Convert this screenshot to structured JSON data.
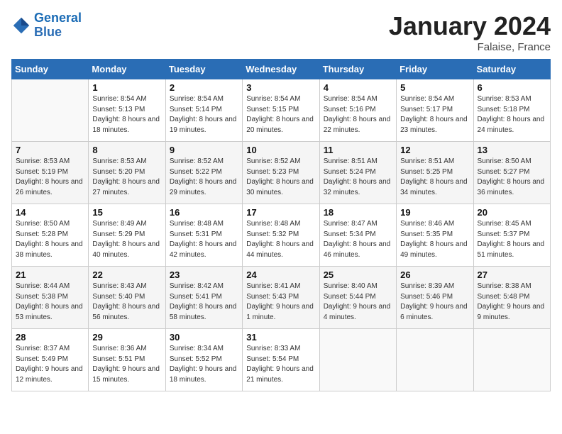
{
  "header": {
    "logo_line1": "General",
    "logo_line2": "Blue",
    "month_year": "January 2024",
    "location": "Falaise, France"
  },
  "weekdays": [
    "Sunday",
    "Monday",
    "Tuesday",
    "Wednesday",
    "Thursday",
    "Friday",
    "Saturday"
  ],
  "weeks": [
    [
      {
        "day": "",
        "sunrise": "",
        "sunset": "",
        "daylight": ""
      },
      {
        "day": "1",
        "sunrise": "Sunrise: 8:54 AM",
        "sunset": "Sunset: 5:13 PM",
        "daylight": "Daylight: 8 hours and 18 minutes."
      },
      {
        "day": "2",
        "sunrise": "Sunrise: 8:54 AM",
        "sunset": "Sunset: 5:14 PM",
        "daylight": "Daylight: 8 hours and 19 minutes."
      },
      {
        "day": "3",
        "sunrise": "Sunrise: 8:54 AM",
        "sunset": "Sunset: 5:15 PM",
        "daylight": "Daylight: 8 hours and 20 minutes."
      },
      {
        "day": "4",
        "sunrise": "Sunrise: 8:54 AM",
        "sunset": "Sunset: 5:16 PM",
        "daylight": "Daylight: 8 hours and 22 minutes."
      },
      {
        "day": "5",
        "sunrise": "Sunrise: 8:54 AM",
        "sunset": "Sunset: 5:17 PM",
        "daylight": "Daylight: 8 hours and 23 minutes."
      },
      {
        "day": "6",
        "sunrise": "Sunrise: 8:53 AM",
        "sunset": "Sunset: 5:18 PM",
        "daylight": "Daylight: 8 hours and 24 minutes."
      }
    ],
    [
      {
        "day": "7",
        "sunrise": "Sunrise: 8:53 AM",
        "sunset": "Sunset: 5:19 PM",
        "daylight": "Daylight: 8 hours and 26 minutes."
      },
      {
        "day": "8",
        "sunrise": "Sunrise: 8:53 AM",
        "sunset": "Sunset: 5:20 PM",
        "daylight": "Daylight: 8 hours and 27 minutes."
      },
      {
        "day": "9",
        "sunrise": "Sunrise: 8:52 AM",
        "sunset": "Sunset: 5:22 PM",
        "daylight": "Daylight: 8 hours and 29 minutes."
      },
      {
        "day": "10",
        "sunrise": "Sunrise: 8:52 AM",
        "sunset": "Sunset: 5:23 PM",
        "daylight": "Daylight: 8 hours and 30 minutes."
      },
      {
        "day": "11",
        "sunrise": "Sunrise: 8:51 AM",
        "sunset": "Sunset: 5:24 PM",
        "daylight": "Daylight: 8 hours and 32 minutes."
      },
      {
        "day": "12",
        "sunrise": "Sunrise: 8:51 AM",
        "sunset": "Sunset: 5:25 PM",
        "daylight": "Daylight: 8 hours and 34 minutes."
      },
      {
        "day": "13",
        "sunrise": "Sunrise: 8:50 AM",
        "sunset": "Sunset: 5:27 PM",
        "daylight": "Daylight: 8 hours and 36 minutes."
      }
    ],
    [
      {
        "day": "14",
        "sunrise": "Sunrise: 8:50 AM",
        "sunset": "Sunset: 5:28 PM",
        "daylight": "Daylight: 8 hours and 38 minutes."
      },
      {
        "day": "15",
        "sunrise": "Sunrise: 8:49 AM",
        "sunset": "Sunset: 5:29 PM",
        "daylight": "Daylight: 8 hours and 40 minutes."
      },
      {
        "day": "16",
        "sunrise": "Sunrise: 8:48 AM",
        "sunset": "Sunset: 5:31 PM",
        "daylight": "Daylight: 8 hours and 42 minutes."
      },
      {
        "day": "17",
        "sunrise": "Sunrise: 8:48 AM",
        "sunset": "Sunset: 5:32 PM",
        "daylight": "Daylight: 8 hours and 44 minutes."
      },
      {
        "day": "18",
        "sunrise": "Sunrise: 8:47 AM",
        "sunset": "Sunset: 5:34 PM",
        "daylight": "Daylight: 8 hours and 46 minutes."
      },
      {
        "day": "19",
        "sunrise": "Sunrise: 8:46 AM",
        "sunset": "Sunset: 5:35 PM",
        "daylight": "Daylight: 8 hours and 49 minutes."
      },
      {
        "day": "20",
        "sunrise": "Sunrise: 8:45 AM",
        "sunset": "Sunset: 5:37 PM",
        "daylight": "Daylight: 8 hours and 51 minutes."
      }
    ],
    [
      {
        "day": "21",
        "sunrise": "Sunrise: 8:44 AM",
        "sunset": "Sunset: 5:38 PM",
        "daylight": "Daylight: 8 hours and 53 minutes."
      },
      {
        "day": "22",
        "sunrise": "Sunrise: 8:43 AM",
        "sunset": "Sunset: 5:40 PM",
        "daylight": "Daylight: 8 hours and 56 minutes."
      },
      {
        "day": "23",
        "sunrise": "Sunrise: 8:42 AM",
        "sunset": "Sunset: 5:41 PM",
        "daylight": "Daylight: 8 hours and 58 minutes."
      },
      {
        "day": "24",
        "sunrise": "Sunrise: 8:41 AM",
        "sunset": "Sunset: 5:43 PM",
        "daylight": "Daylight: 9 hours and 1 minute."
      },
      {
        "day": "25",
        "sunrise": "Sunrise: 8:40 AM",
        "sunset": "Sunset: 5:44 PM",
        "daylight": "Daylight: 9 hours and 4 minutes."
      },
      {
        "day": "26",
        "sunrise": "Sunrise: 8:39 AM",
        "sunset": "Sunset: 5:46 PM",
        "daylight": "Daylight: 9 hours and 6 minutes."
      },
      {
        "day": "27",
        "sunrise": "Sunrise: 8:38 AM",
        "sunset": "Sunset: 5:48 PM",
        "daylight": "Daylight: 9 hours and 9 minutes."
      }
    ],
    [
      {
        "day": "28",
        "sunrise": "Sunrise: 8:37 AM",
        "sunset": "Sunset: 5:49 PM",
        "daylight": "Daylight: 9 hours and 12 minutes."
      },
      {
        "day": "29",
        "sunrise": "Sunrise: 8:36 AM",
        "sunset": "Sunset: 5:51 PM",
        "daylight": "Daylight: 9 hours and 15 minutes."
      },
      {
        "day": "30",
        "sunrise": "Sunrise: 8:34 AM",
        "sunset": "Sunset: 5:52 PM",
        "daylight": "Daylight: 9 hours and 18 minutes."
      },
      {
        "day": "31",
        "sunrise": "Sunrise: 8:33 AM",
        "sunset": "Sunset: 5:54 PM",
        "daylight": "Daylight: 9 hours and 21 minutes."
      },
      {
        "day": "",
        "sunrise": "",
        "sunset": "",
        "daylight": ""
      },
      {
        "day": "",
        "sunrise": "",
        "sunset": "",
        "daylight": ""
      },
      {
        "day": "",
        "sunrise": "",
        "sunset": "",
        "daylight": ""
      }
    ]
  ]
}
